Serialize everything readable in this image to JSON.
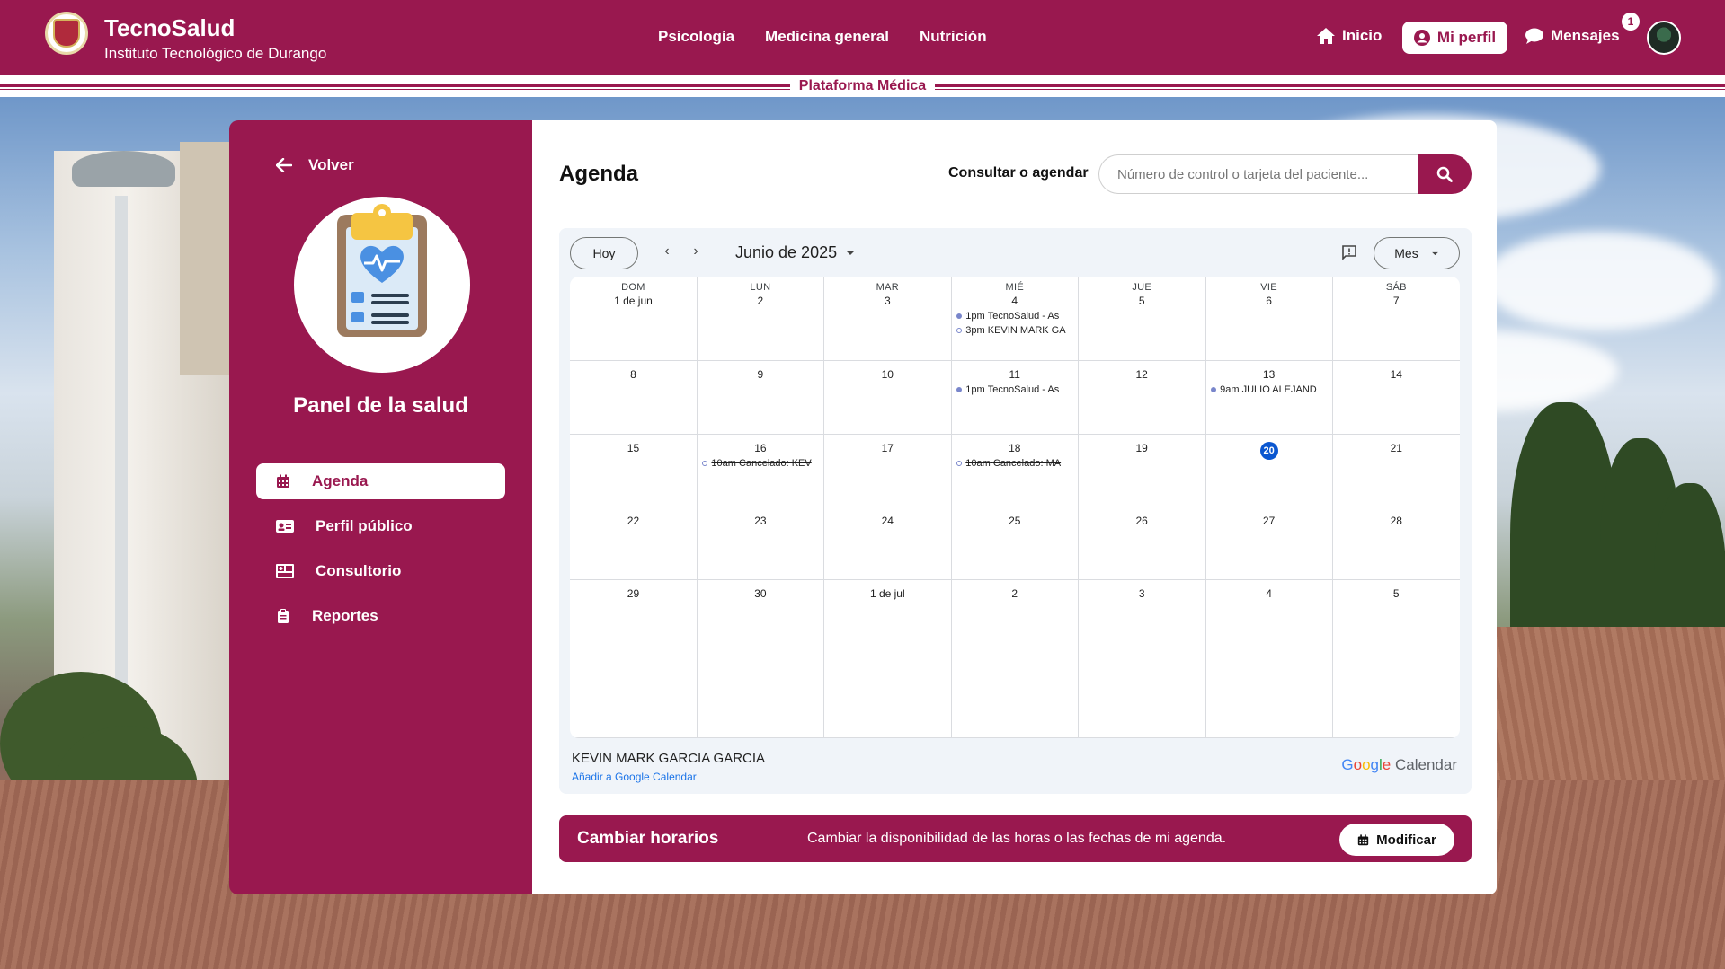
{
  "header": {
    "brand_title": "TecnoSalud",
    "brand_subtitle": "Instituto Tecnológico de Durango",
    "nav": [
      "Psicología",
      "Medicina general",
      "Nutrición"
    ],
    "inicio": "Inicio",
    "mi_perfil": "Mi perfil",
    "mensajes": "Mensajes",
    "mensajes_badge": "1",
    "primary_color": "#99184f"
  },
  "subbar": {
    "label": "Plataforma Médica"
  },
  "sidebar": {
    "back": "Volver",
    "panel_title": "Panel de la salud",
    "items": [
      {
        "label": "Agenda",
        "icon": "calendar-icon",
        "active": true
      },
      {
        "label": "Perfil público",
        "icon": "id-card-icon",
        "active": false
      },
      {
        "label": "Consultorio",
        "icon": "clinic-icon",
        "active": false
      },
      {
        "label": "Reportes",
        "icon": "clipboard-icon",
        "active": false
      }
    ]
  },
  "main": {
    "title": "Agenda",
    "consult_label": "Consultar o agendar",
    "search_placeholder": "Número de control o tarjeta del paciente..."
  },
  "calendar": {
    "today_button": "Hoy",
    "month_label": "Junio de 2025",
    "view_button": "Mes",
    "weekdays": [
      "DOM",
      "LUN",
      "MAR",
      "MIÉ",
      "JUE",
      "VIE",
      "SÁB"
    ],
    "weeks": [
      [
        {
          "day": "1 de jun",
          "events": []
        },
        {
          "day": "2",
          "events": []
        },
        {
          "day": "3",
          "events": []
        },
        {
          "day": "4",
          "events": [
            {
              "time": "1pm",
              "title": "TecnoSalud - As",
              "style": "filled",
              "cancelled": false
            },
            {
              "time": "3pm",
              "title": "KEVIN MARK GA",
              "style": "hollow",
              "cancelled": false
            }
          ]
        },
        {
          "day": "5",
          "events": []
        },
        {
          "day": "6",
          "events": []
        },
        {
          "day": "7",
          "events": []
        }
      ],
      [
        {
          "day": "8",
          "events": []
        },
        {
          "day": "9",
          "events": []
        },
        {
          "day": "10",
          "events": []
        },
        {
          "day": "11",
          "events": [
            {
              "time": "1pm",
              "title": "TecnoSalud - As",
              "style": "filled",
              "cancelled": false
            }
          ]
        },
        {
          "day": "12",
          "events": []
        },
        {
          "day": "13",
          "events": [
            {
              "time": "9am",
              "title": "JULIO ALEJAND",
              "style": "filled",
              "cancelled": false
            }
          ]
        },
        {
          "day": "14",
          "events": []
        }
      ],
      [
        {
          "day": "15",
          "events": []
        },
        {
          "day": "16",
          "events": [
            {
              "time": "10am",
              "title": "Cancelado: KEV",
              "style": "hollow",
              "cancelled": true
            }
          ]
        },
        {
          "day": "17",
          "events": []
        },
        {
          "day": "18",
          "events": [
            {
              "time": "10am",
              "title": "Cancelado: MA",
              "style": "hollow",
              "cancelled": true
            }
          ]
        },
        {
          "day": "19",
          "events": []
        },
        {
          "day": "20",
          "events": [],
          "today": true
        },
        {
          "day": "21",
          "events": []
        }
      ],
      [
        {
          "day": "22",
          "events": []
        },
        {
          "day": "23",
          "events": []
        },
        {
          "day": "24",
          "events": []
        },
        {
          "day": "25",
          "events": []
        },
        {
          "day": "26",
          "events": []
        },
        {
          "day": "27",
          "events": []
        },
        {
          "day": "28",
          "events": []
        }
      ],
      [
        {
          "day": "29",
          "events": []
        },
        {
          "day": "30",
          "events": []
        },
        {
          "day": "1 de jul",
          "events": []
        },
        {
          "day": "2",
          "events": []
        },
        {
          "day": "3",
          "events": []
        },
        {
          "day": "4",
          "events": []
        },
        {
          "day": "5",
          "events": []
        }
      ]
    ],
    "owner_name": "KEVIN MARK GARCIA GARCIA",
    "add_link": "Añadir a Google Calendar",
    "brand_google": "Google",
    "brand_calendar": "Calendar"
  },
  "cambiar": {
    "title": "Cambiar horarios",
    "description": "Cambiar la disponibilidad de las horas o las fechas de mi agenda.",
    "button": "Modificar"
  }
}
